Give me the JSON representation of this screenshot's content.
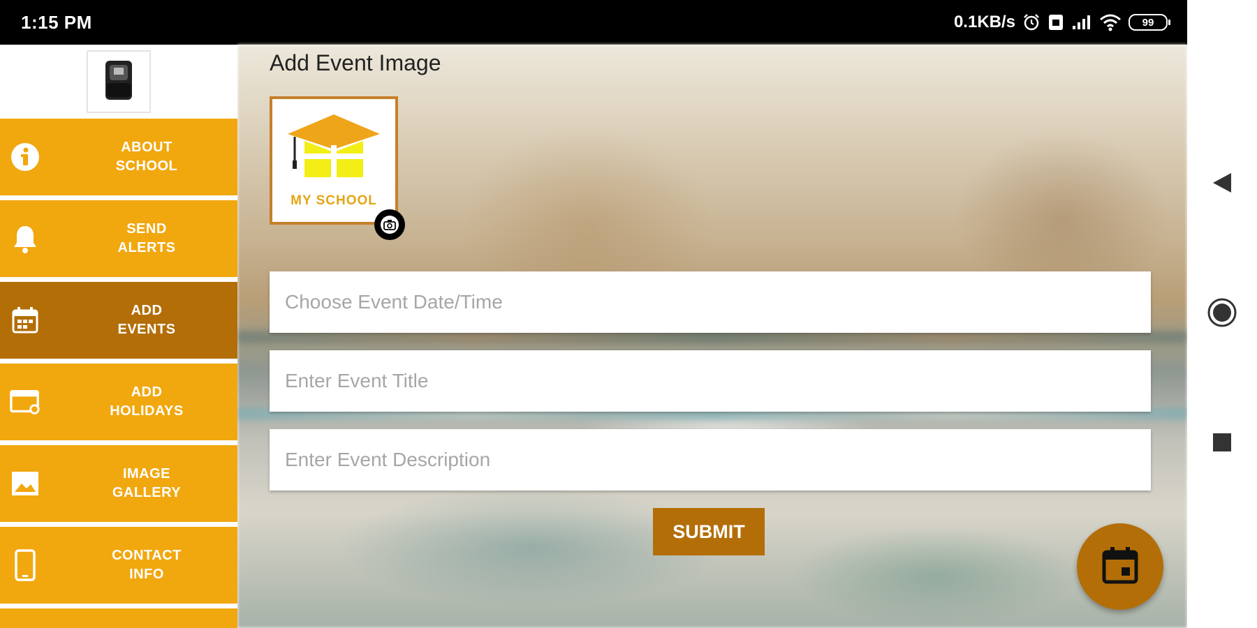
{
  "status_bar": {
    "time": "1:15 PM",
    "network_speed": "0.1KB/s",
    "battery": "99",
    "icons": [
      "alarm-icon",
      "sim-icon",
      "signal-icon",
      "wifi-icon",
      "battery-icon"
    ]
  },
  "sidebar": {
    "logo": "school-logo-icon",
    "items": [
      {
        "label": "ABOUT\nSCHOOL",
        "icon": "info-icon",
        "active": false
      },
      {
        "label": "SEND\nALERTS",
        "icon": "bell-icon",
        "active": false
      },
      {
        "label": "ADD\nEVENTS",
        "icon": "calendar-icon",
        "active": true
      },
      {
        "label": "ADD\nHOLIDAYS",
        "icon": "holiday-icon",
        "active": false
      },
      {
        "label": "IMAGE\nGALLERY",
        "icon": "image-icon",
        "active": false
      },
      {
        "label": "CONTACT\nINFO",
        "icon": "phone-icon",
        "active": false
      }
    ]
  },
  "main": {
    "heading": "Add Event Image",
    "event_image": {
      "text": "MY SCHOOL"
    },
    "fields": {
      "date_placeholder": "Choose Event Date/Time",
      "title_placeholder": "Enter Event Title",
      "description_placeholder": "Enter Event Description"
    },
    "submit_label": "SUBMIT",
    "fab_icon": "calendar-event-icon"
  },
  "nav_bar": {
    "buttons": [
      "back-icon",
      "home-icon",
      "recents-icon"
    ]
  },
  "colors": {
    "accent": "#f1a70e",
    "accent_dark": "#b36e08",
    "status_bar": "#000000"
  }
}
